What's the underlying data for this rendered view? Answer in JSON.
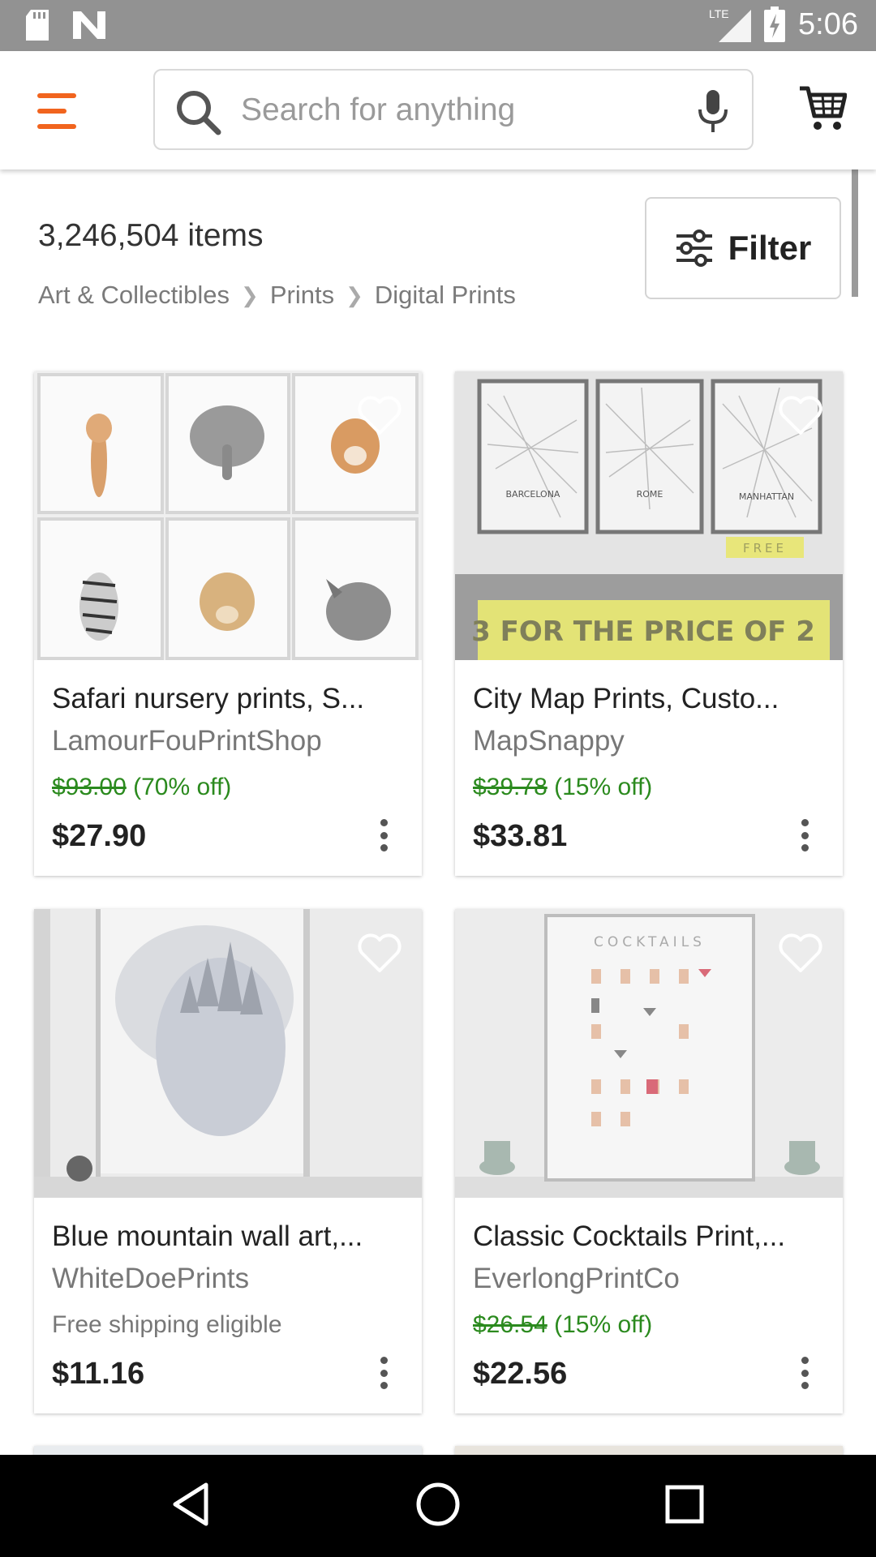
{
  "status_bar": {
    "time": "5:06",
    "network": "LTE",
    "icons": [
      "sd-card-icon",
      "n-logo-icon",
      "lte-signal-icon",
      "battery-charging-icon"
    ]
  },
  "app_bar": {
    "search_placeholder": "Search for anything",
    "icons": [
      "hamburger-menu-icon",
      "search-icon",
      "microphone-icon",
      "cart-icon"
    ],
    "accent_color": "#f1641e"
  },
  "results": {
    "count": "3,246,504 items",
    "breadcrumb": [
      "Art & Collectibles",
      "Prints",
      "Digital Prints"
    ],
    "filter_label": "Filter"
  },
  "listings": [
    {
      "title": "Safari nursery prints, S...",
      "shop": "LamourFouPrintShop",
      "original_price": "$93.00",
      "discount": "(70% off)",
      "price": "$27.90"
    },
    {
      "title": "City Map Prints, Custo...",
      "shop": "MapSnappy",
      "original_price": "$39.78",
      "discount": "(15% off)",
      "price": "$33.81",
      "image_text": {
        "map1": "BARCELONA",
        "map2": "ROME",
        "map3": "MANHATTAN",
        "tag": "FREE",
        "banner": "3 FOR THE PRICE OF 2"
      }
    },
    {
      "title": "Blue mountain wall art,...",
      "shop": "WhiteDoePrints",
      "note": "Free shipping eligible",
      "price": "$11.16"
    },
    {
      "title": "Classic Cocktails Print,...",
      "shop": "EverlongPrintCo",
      "original_price": "$26.54",
      "discount": "(15% off)",
      "price": "$22.56",
      "image_text": {
        "poster_title": "COCKTAILS"
      }
    }
  ],
  "nav_bar": {
    "icons": [
      "back-triangle-icon",
      "home-circle-icon",
      "recents-square-icon"
    ]
  }
}
